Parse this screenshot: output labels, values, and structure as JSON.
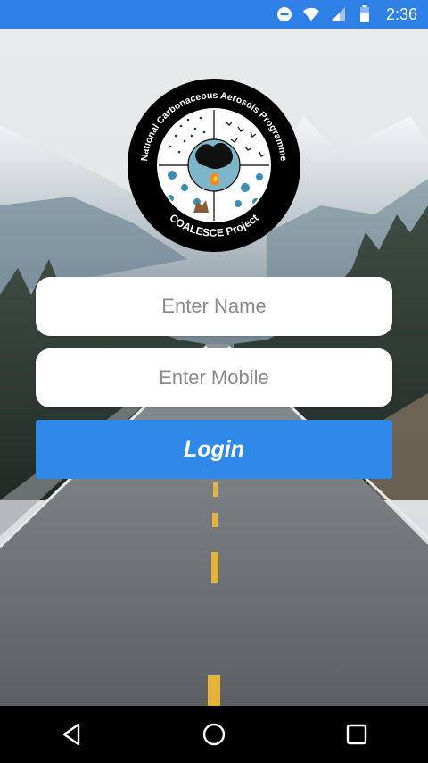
{
  "status_bar": {
    "time": "2:36",
    "icons": [
      "do-not-disturb-icon",
      "wifi-icon",
      "cell-signal-icon",
      "battery-icon"
    ]
  },
  "logo": {
    "arc_text": "National Carbonaceous Aerosols Programme",
    "project_text": "COALESCE Project"
  },
  "form": {
    "name_placeholder": "Enter Name",
    "name_value": "",
    "mobile_placeholder": "Enter Mobile",
    "mobile_value": "",
    "login_label": "Login"
  },
  "nav_bar": {
    "icons": [
      "back-icon",
      "home-icon",
      "recents-icon"
    ]
  },
  "colors": {
    "status_bar": "#2f80e6",
    "button": "#2f88e8",
    "nav_bar": "#000000"
  }
}
